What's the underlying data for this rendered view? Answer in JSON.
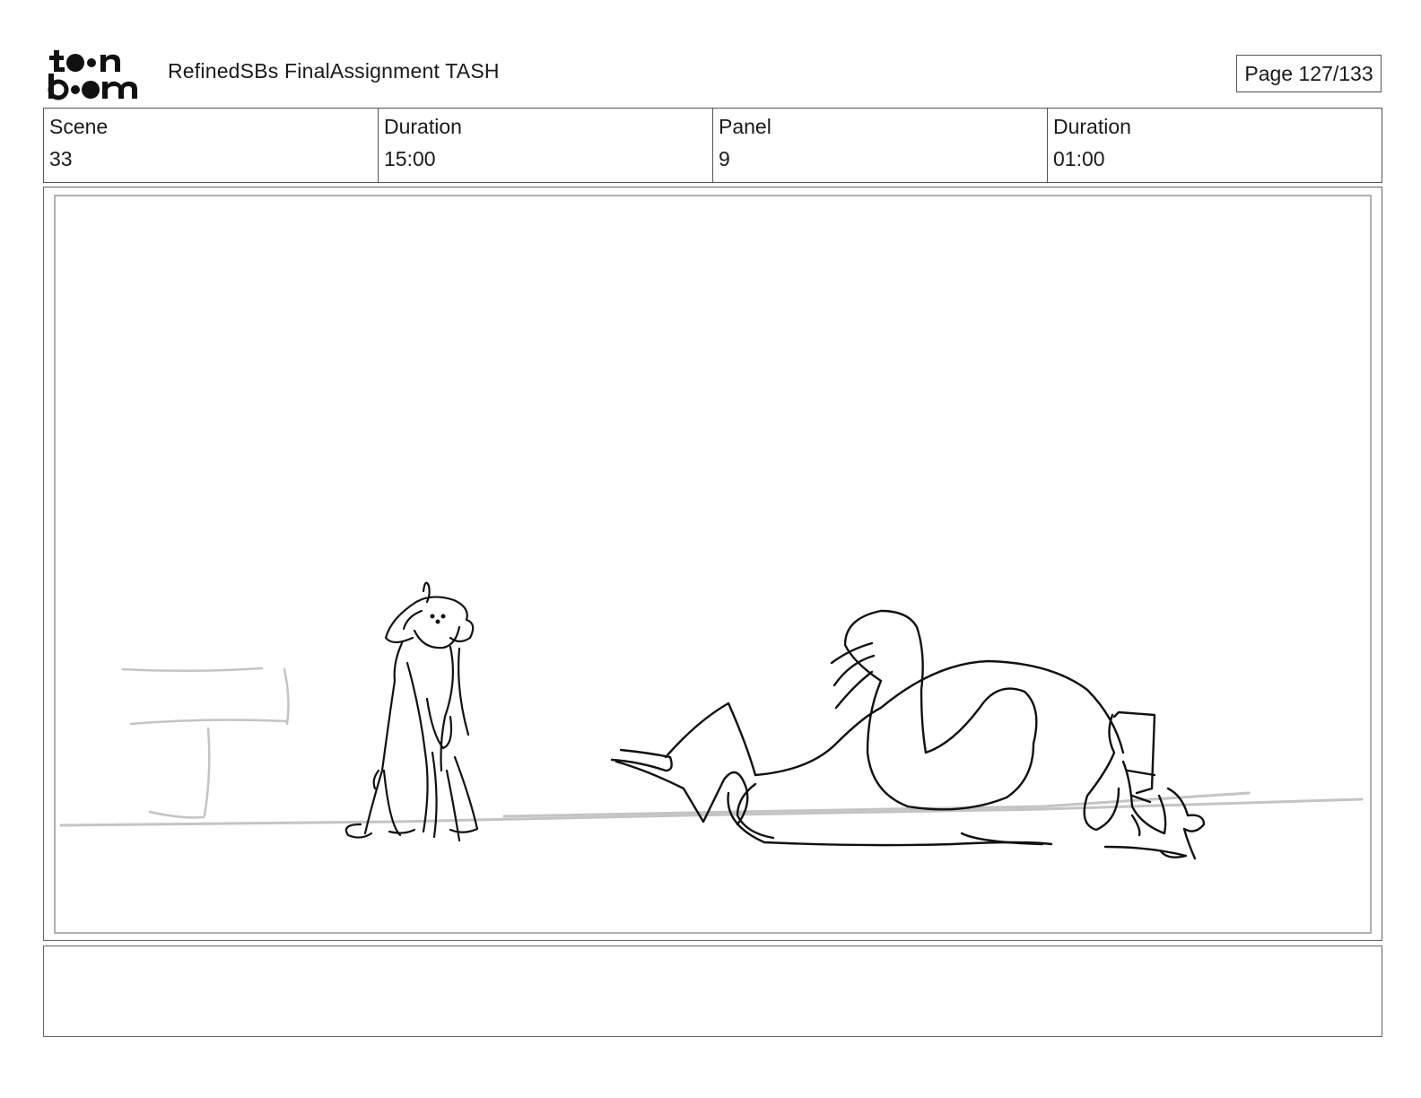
{
  "header": {
    "logo_line1": "toon",
    "logo_line2": "boom",
    "title": "RefinedSBs FinalAssignment TASH",
    "page_label": "Page 127/133"
  },
  "info": {
    "scene_label": "Scene",
    "scene_value": "33",
    "scene_duration_label": "Duration",
    "scene_duration_value": "15:00",
    "panel_label": "Panel",
    "panel_value": "9",
    "panel_duration_label": "Duration",
    "panel_duration_value": "01:00"
  },
  "panel": {
    "image_name": "storyboard-sketch"
  },
  "notes": {
    "text": ""
  }
}
